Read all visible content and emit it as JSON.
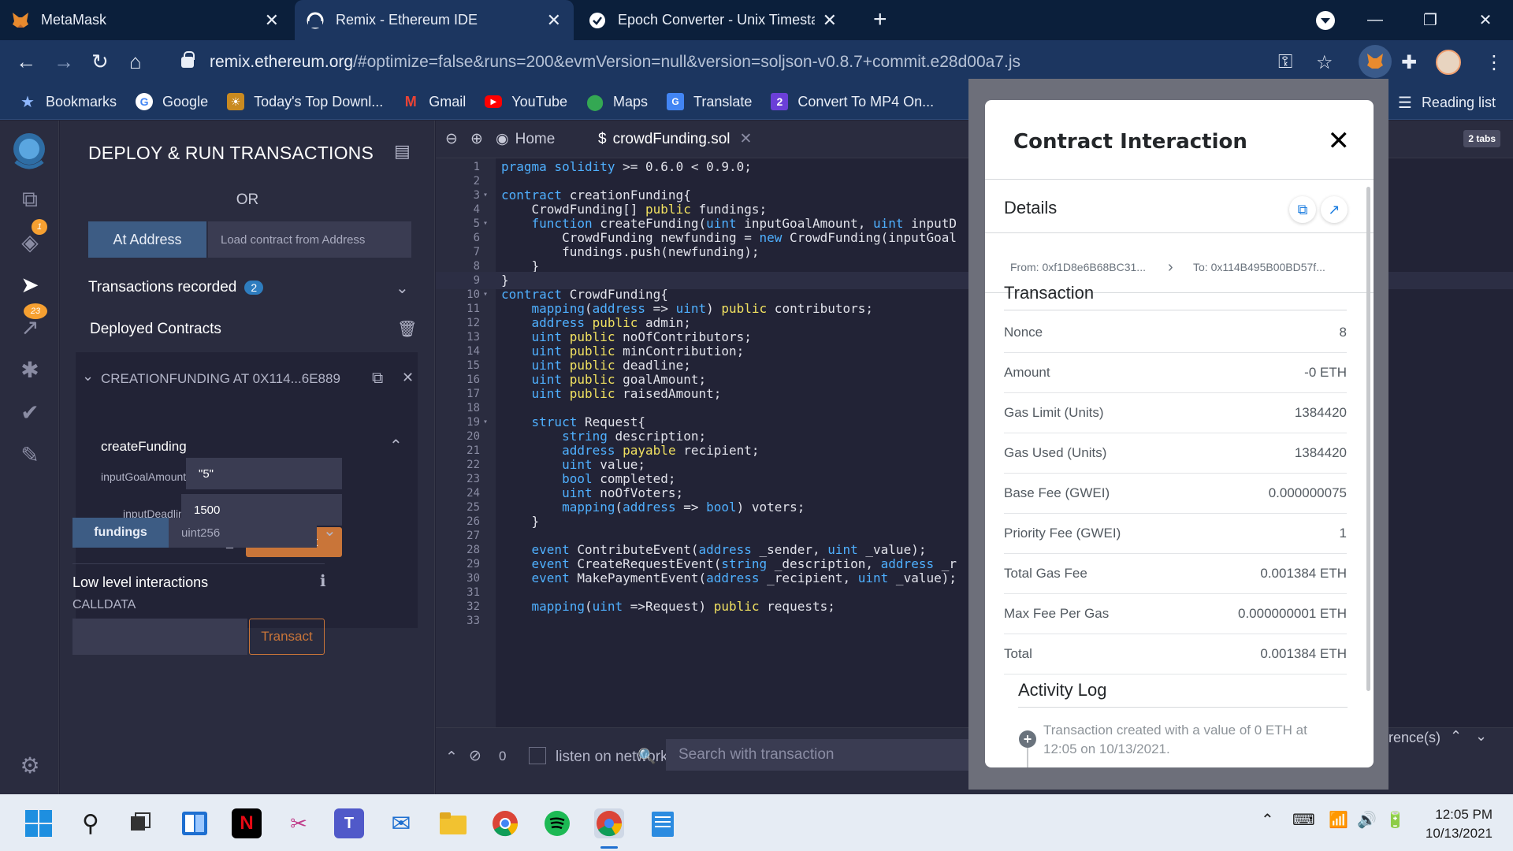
{
  "browser": {
    "tabs": [
      {
        "title": "MetaMask",
        "active": false
      },
      {
        "title": "Remix - Ethereum IDE",
        "active": true
      },
      {
        "title": "Epoch Converter - Unix Timestam",
        "active": false
      }
    ],
    "url_host": "remix.ethereum.org",
    "url_rest": "/#optimize=false&runs=200&evmVersion=null&version=soljson-v0.8.7+commit.e28d00a7.js",
    "bookmarks": [
      "Bookmarks",
      "Google",
      "Today's Top Downl...",
      "Gmail",
      "YouTube",
      "Maps",
      "Translate",
      "Convert To MP4 On..."
    ],
    "reading_list": "Reading list"
  },
  "remix": {
    "icon_badges": {
      "plugin": "1",
      "analysis": "23"
    },
    "sidepanel": {
      "title": "DEPLOY & RUN TRANSACTIONS",
      "or": "OR",
      "at_address": "At Address",
      "load_placeholder": "Load contract from Address",
      "transactions_recorded": "Transactions recorded",
      "transactions_count": "2",
      "deployed_contracts": "Deployed Contracts",
      "instance": "CREATIONFUNDING AT 0X114...6E889",
      "fn_name": "createFunding",
      "param1_label": "inputGoalAmount:",
      "param1_value": "\"5\"",
      "param2_label": "inputDeadline:",
      "param2_value": "1500",
      "transact": "transact",
      "fundings": "fundings",
      "fundings_placeholder": "uint256",
      "low_level": "Low level interactions",
      "calldata": "CALLDATA",
      "transact2": "Transact"
    },
    "editor": {
      "tab_home": "Home",
      "tab_file": "crowdFunding.sol",
      "two_tabs": "2 tabs",
      "lines": [
        {
          "n": "1",
          "t": "pragma solidity >= 0.6.0 < 0.9.0;"
        },
        {
          "n": "2",
          "t": ""
        },
        {
          "n": "3",
          "t": "contract creationFunding{"
        },
        {
          "n": "4",
          "t": "    CrowdFunding[] public fundings;"
        },
        {
          "n": "5",
          "t": "    function createFunding(uint inputGoalAmount, uint inputD"
        },
        {
          "n": "6",
          "t": "        CrowdFunding newfunding = new CrowdFunding(inputGoal"
        },
        {
          "n": "7",
          "t": "        fundings.push(newfunding);"
        },
        {
          "n": "8",
          "t": "    }"
        },
        {
          "n": "9",
          "t": "}"
        },
        {
          "n": "10",
          "t": "contract CrowdFunding{"
        },
        {
          "n": "11",
          "t": "    mapping(address => uint) public contributors;"
        },
        {
          "n": "12",
          "t": "    address public admin;"
        },
        {
          "n": "13",
          "t": "    uint public noOfContributors;"
        },
        {
          "n": "14",
          "t": "    uint public minContribution;"
        },
        {
          "n": "15",
          "t": "    uint public deadline;"
        },
        {
          "n": "16",
          "t": "    uint public goalAmount;"
        },
        {
          "n": "17",
          "t": "    uint public raisedAmount;"
        },
        {
          "n": "18",
          "t": ""
        },
        {
          "n": "19",
          "t": "    struct Request{"
        },
        {
          "n": "20",
          "t": "        string description;"
        },
        {
          "n": "21",
          "t": "        address payable recipient;"
        },
        {
          "n": "22",
          "t": "        uint value;"
        },
        {
          "n": "23",
          "t": "        bool completed;"
        },
        {
          "n": "24",
          "t": "        uint noOfVoters;"
        },
        {
          "n": "25",
          "t": "        mapping(address => bool) voters;"
        },
        {
          "n": "26",
          "t": "    }"
        },
        {
          "n": "27",
          "t": ""
        },
        {
          "n": "28",
          "t": "    event ContributeEvent(address _sender, uint _value);"
        },
        {
          "n": "29",
          "t": "    event CreateRequestEvent(string _description, address _r"
        },
        {
          "n": "30",
          "t": "    event MakePaymentEvent(address _recipient, uint _value);"
        },
        {
          "n": "31",
          "t": ""
        },
        {
          "n": "32",
          "t": "    mapping(uint =>Request) public requests;"
        },
        {
          "n": "33",
          "t": ""
        }
      ]
    },
    "terminal": {
      "count": "0",
      "listen": "listen on network",
      "search_placeholder": "Search with transaction",
      "reference": "rence(s)"
    }
  },
  "metamask": {
    "title": "Contract Interaction",
    "details_label": "Details",
    "from": "From: 0xf1D8e6B68BC31...",
    "to": "To: 0x114B495B00BD57f...",
    "transaction_label": "Transaction",
    "rows": [
      {
        "k": "Nonce",
        "v": "8"
      },
      {
        "k": "Amount",
        "v": "-0 ETH"
      },
      {
        "k": "Gas Limit (Units)",
        "v": "1384420"
      },
      {
        "k": "Gas Used (Units)",
        "v": "1384420"
      },
      {
        "k": "Base Fee (GWEI)",
        "v": "0.000000075"
      },
      {
        "k": "Priority Fee (GWEI)",
        "v": "1"
      },
      {
        "k": "Total Gas Fee",
        "v": "0.001384 ETH"
      },
      {
        "k": "Max Fee Per Gas",
        "v": "0.000000001 ETH"
      },
      {
        "k": "Total",
        "v": "0.001384 ETH"
      }
    ],
    "activity_label": "Activity Log",
    "activity_text": "Transaction created with a value of 0 ETH at 12:05 on 10/13/2021."
  },
  "taskbar": {
    "time": "12:05 PM",
    "date": "10/13/2021"
  },
  "colors": {
    "remix_bg": "#222336",
    "remix_panel": "#2a2c3f",
    "accent_orange": "#c97539",
    "accent_blue": "#3d5c84",
    "chrome_dark": "#0b1f3b",
    "chrome_toolbar": "#1c3660"
  }
}
